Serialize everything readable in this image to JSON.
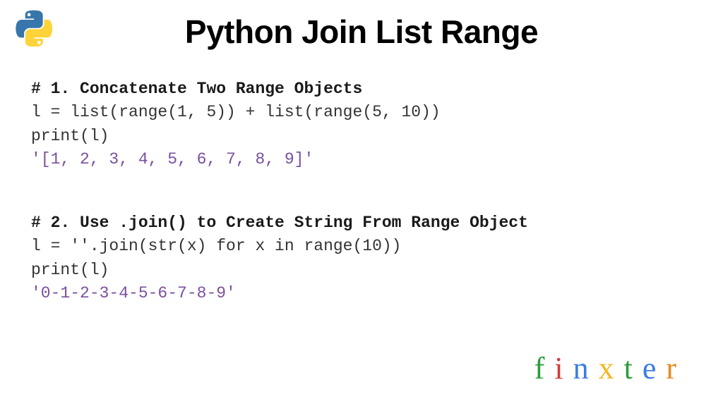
{
  "title": "Python Join List Range",
  "logo_alt": "python-logo",
  "block1": {
    "comment": "# 1. Concatenate Two Range Objects",
    "line1": "l = list(range(1, 5)) + list(range(5, 10))",
    "line2": "print(l)",
    "output": "'[1, 2, 3, 4, 5, 6, 7, 8, 9]'"
  },
  "block2": {
    "comment": "# 2. Use .join() to Create String From Range Object",
    "line1": "l = ''.join(str(x) for x in range(10))",
    "line2": "print(l)",
    "output": "'0-1-2-3-4-5-6-7-8-9'"
  },
  "brand": {
    "f": "f",
    "i": "i",
    "n": "n",
    "x": "x",
    "t": "t",
    "e": "e",
    "r": "r"
  }
}
